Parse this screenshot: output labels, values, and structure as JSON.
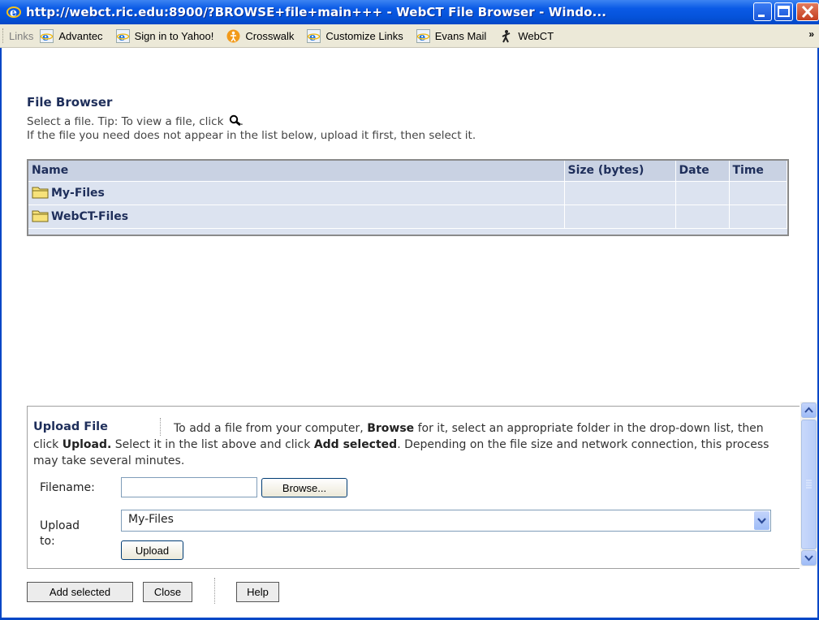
{
  "window": {
    "title": "http://webct.ric.edu:8900/?BROWSE+file+main+++ - WebCT File Browser - Windo..."
  },
  "links_bar": {
    "label": "Links",
    "items": [
      {
        "label": "Advantec",
        "icon": "ie-icon"
      },
      {
        "label": "Sign in to Yahoo!",
        "icon": "ie-icon"
      },
      {
        "label": "Crosswalk",
        "icon": "crosswalk-icon"
      },
      {
        "label": "Customize Links",
        "icon": "ie-icon"
      },
      {
        "label": "Evans Mail",
        "icon": "ie-icon"
      },
      {
        "label": "WebCT",
        "icon": "webct-icon"
      }
    ],
    "overflow": "»"
  },
  "file_browser": {
    "title": "File Browser",
    "tip_prefix": "Select a file. Tip: To view a file, click",
    "tip_suffix": ".",
    "tip2": "If the file you need does not appear in the list below, upload it first, then select it.",
    "columns": [
      "Name",
      "Size (bytes)",
      "Date",
      "Time"
    ],
    "rows": [
      {
        "name": "My-Files",
        "size": "",
        "date": "",
        "time": ""
      },
      {
        "name": "WebCT-Files",
        "size": "",
        "date": "",
        "time": ""
      }
    ]
  },
  "upload": {
    "title": "Upload File",
    "desc_1": "To add a file from your computer,",
    "desc_browse": "Browse",
    "desc_2": "for it, select an appropriate folder in the drop-down list, then click",
    "desc_upload": "Upload.",
    "desc_3": "Select it in the list above and click",
    "desc_add": "Add selected",
    "desc_4": ". Depending on the file size and network connection, this process may take several minutes.",
    "filename_label": "Filename:",
    "filename_value": "",
    "browse_label": "Browse...",
    "upload_to_label_1": "Upload",
    "upload_to_label_2": "to:",
    "selected_folder": "My-Files",
    "upload_label": "Upload"
  },
  "footer": {
    "add_selected": "Add selected",
    "close": "Close",
    "help": "Help"
  },
  "colors": {
    "titlebar": "#0553da",
    "table_header": "#c9d2e3",
    "table_body": "#dce3f0",
    "text_dark_blue": "#1e2e5a"
  }
}
